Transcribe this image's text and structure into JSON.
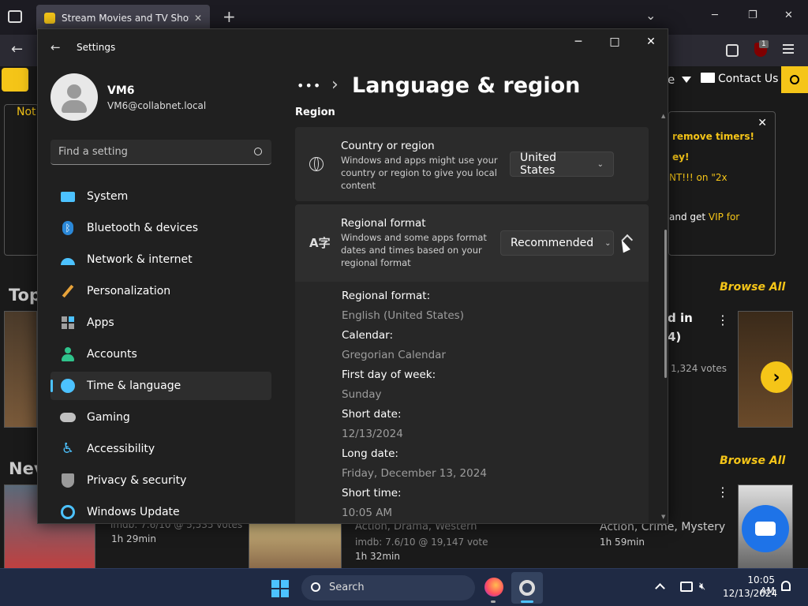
{
  "browser": {
    "tab_title": "Stream Movies and TV Shows F",
    "new_tab": "+",
    "tab_close": "✕",
    "overflow": "⌄",
    "minimize": "─",
    "restore": "❐",
    "close": "✕",
    "back": "←",
    "badge_count": "1"
  },
  "website": {
    "nav_right_partial": "e",
    "contact_us": "Contact Us",
    "not_partial": "Not",
    "promo_lines": [
      "remove timers!",
      "ey!",
      "NT!!! on \"2x",
      "and get VIP for"
    ],
    "promo_vip": "VIP for",
    "top_partial": "Top",
    "new_partial": "Nev",
    "browse_all_1": "Browse All",
    "browse_all_2": "Browse All",
    "card1_title_partial": "d in",
    "card1_sub_partial": "4)",
    "card1_votes": "1,324 votes",
    "row2_c1_imdb": "imdb: 7.6/10 @ 5,535 votes",
    "row2_c1_time": "1h 29min",
    "row2_c2_genre": "Action, Drama, Western",
    "row2_c2_imdb": "imdb: 7.6/10 @ 19,147 vote",
    "row2_c2_time": "1h 32min",
    "row2_c3_genre": "Action, Crime, Mystery",
    "row2_c3_time": "1h 59min"
  },
  "settings": {
    "app_title": "Settings",
    "user": {
      "name": "VM6",
      "email": "VM6@collabnet.local"
    },
    "search_placeholder": "Find a setting",
    "nav": [
      {
        "label": "System",
        "icon": "system-icon"
      },
      {
        "label": "Bluetooth & devices",
        "icon": "bluetooth-icon"
      },
      {
        "label": "Network & internet",
        "icon": "wifi-icon"
      },
      {
        "label": "Personalization",
        "icon": "brush-icon"
      },
      {
        "label": "Apps",
        "icon": "apps-icon"
      },
      {
        "label": "Accounts",
        "icon": "accounts-icon"
      },
      {
        "label": "Time & language",
        "icon": "time-language-icon"
      },
      {
        "label": "Gaming",
        "icon": "gaming-icon"
      },
      {
        "label": "Accessibility",
        "icon": "accessibility-icon"
      },
      {
        "label": "Privacy & security",
        "icon": "shield-icon"
      },
      {
        "label": "Windows Update",
        "icon": "update-icon"
      }
    ],
    "breadcrumb_more": "•••",
    "breadcrumb_sep": "›",
    "page_title": "Language & region",
    "section_region": "Region",
    "country": {
      "title": "Country or region",
      "desc": "Windows and apps might use your country or region to give you local content",
      "value": "United States"
    },
    "regional_format": {
      "title": "Regional format",
      "desc": "Windows and some apps format dates and times based on your regional format",
      "value": "Recommended"
    },
    "details": [
      {
        "label": "Regional format:",
        "value": "English (United States)"
      },
      {
        "label": "Calendar:",
        "value": "Gregorian Calendar"
      },
      {
        "label": "First day of week:",
        "value": "Sunday"
      },
      {
        "label": "Short date:",
        "value": "12/13/2024"
      },
      {
        "label": "Long date:",
        "value": "Friday, December 13, 2024"
      },
      {
        "label": "Short time:",
        "value": "10:05 AM"
      }
    ]
  },
  "taskbar": {
    "search": "Search",
    "time": "10:05 AM",
    "date": "12/13/2024"
  },
  "colors": {
    "accent": "#4cc2ff",
    "imdb_yellow": "#f5c518"
  }
}
